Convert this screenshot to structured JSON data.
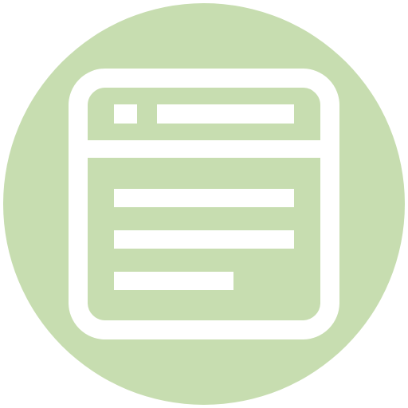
{
  "icon": {
    "name": "browser-window-icon",
    "background_color": "#c7ddb0",
    "foreground_color": "#ffffff"
  }
}
